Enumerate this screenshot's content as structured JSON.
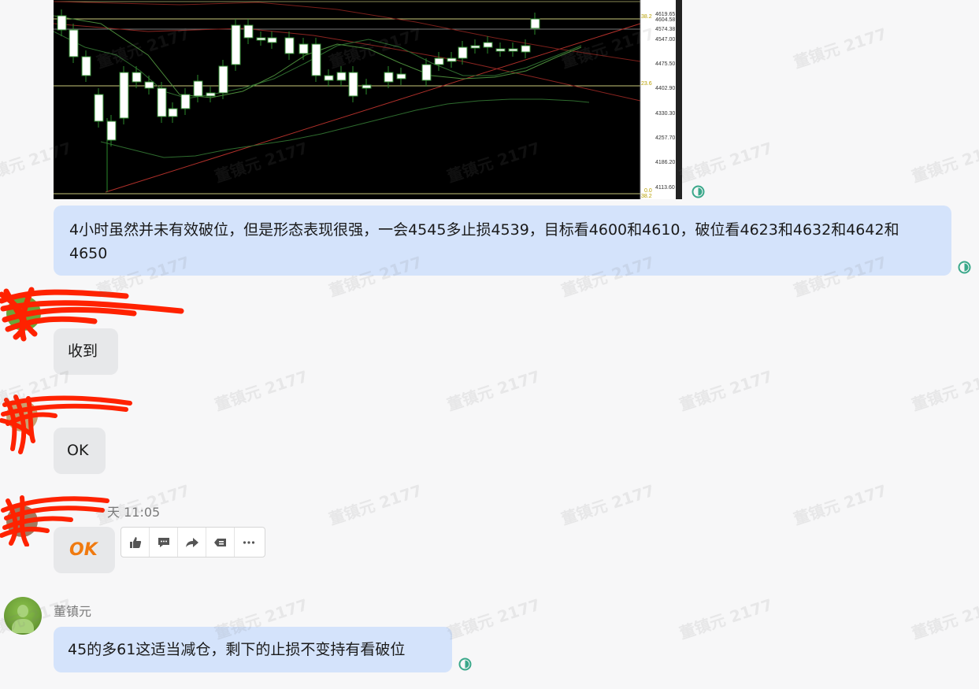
{
  "chart_image": {
    "price_labels": [
      "4619.65",
      "4604.58",
      "4574.38",
      "4547.00",
      "4475.50",
      "4402.90",
      "4330.30",
      "4257.70",
      "4186.20",
      "4113.60"
    ],
    "fib_labels": [
      "38.2",
      "23.6",
      "0.0",
      "38.2"
    ]
  },
  "messages": [
    {
      "sender": "self",
      "text": "4小时虽然并未有效破位，但是形态表现很强，一会4545多止损4539，目标看4600和4610，破位看4623和4632和4642和4650"
    },
    {
      "sender": "other",
      "text": "收到"
    },
    {
      "sender": "other",
      "text": "OK"
    },
    {
      "sender": "other",
      "time_fragment": "天 11:05",
      "sticker_text": "OK"
    },
    {
      "sender": "self",
      "sender_name": "董镇元",
      "text": "45的多61这适当减仓，剩下的止损不变持有看破位"
    }
  ],
  "watermark": "董镇元 2177",
  "message_actions": [
    "like-icon",
    "comment-icon",
    "forward-icon",
    "multi-select-icon",
    "more-icon"
  ]
}
